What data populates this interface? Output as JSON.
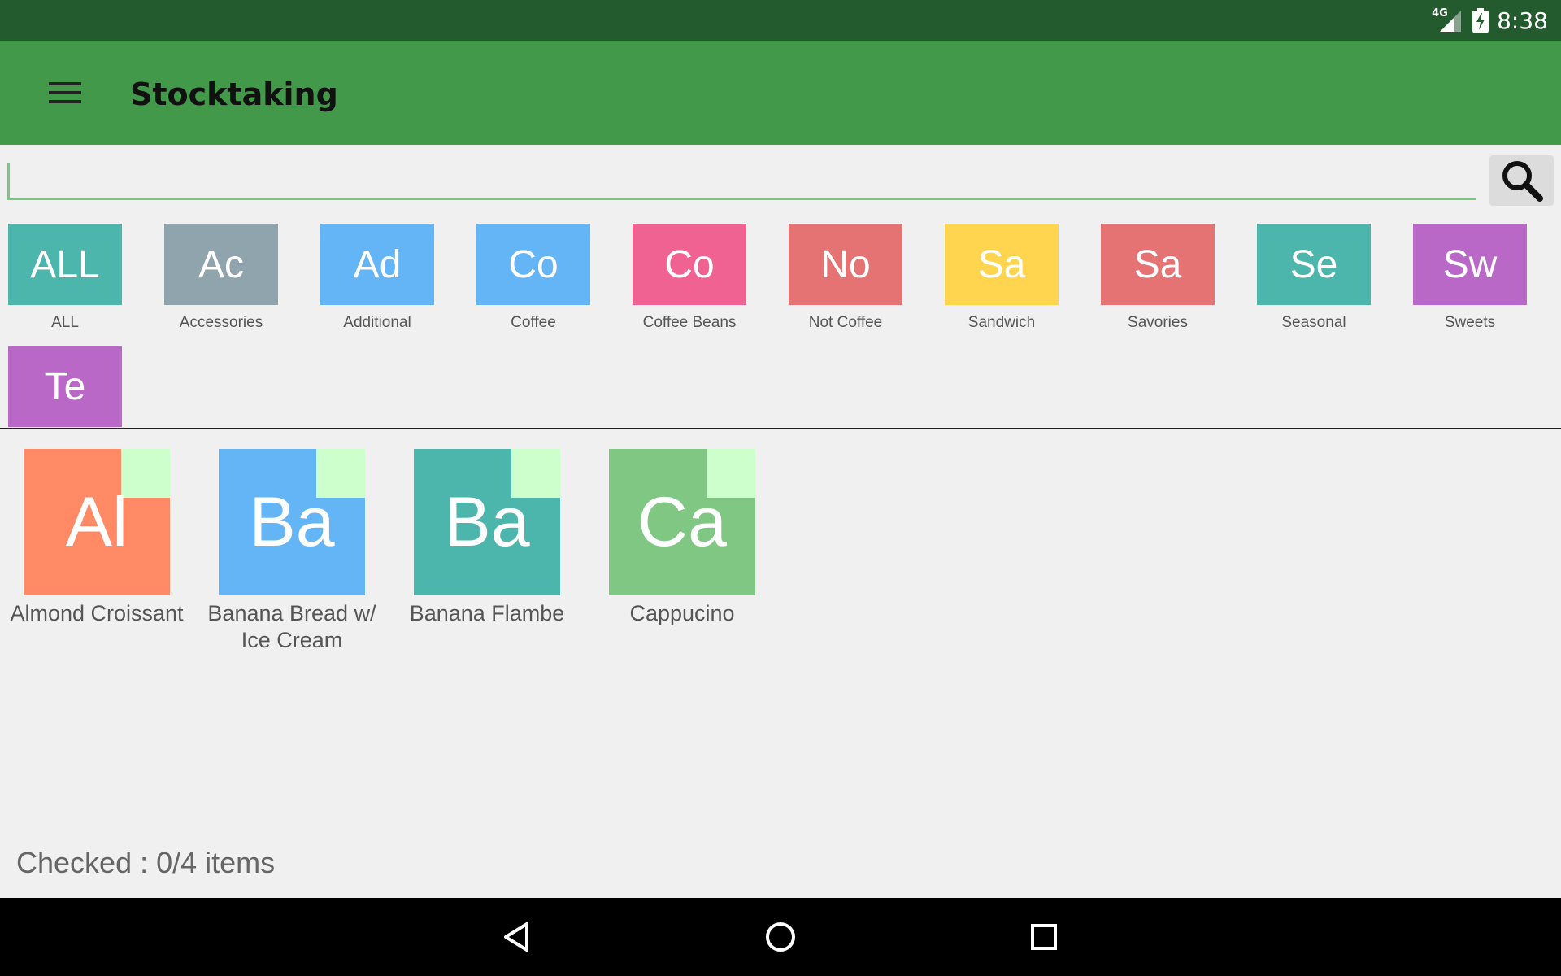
{
  "status_bar": {
    "network": "4G",
    "time": "8:38"
  },
  "app_bar": {
    "title": "Stocktaking",
    "menu_icon": "hamburger-icon"
  },
  "search": {
    "value": "",
    "placeholder": "",
    "button_icon": "search-icon"
  },
  "categories": [
    {
      "abbr": "ALL",
      "label": "ALL",
      "color": "#4db6ac"
    },
    {
      "abbr": "Ac",
      "label": "Accessories",
      "color": "#90a4ae"
    },
    {
      "abbr": "Ad",
      "label": "Additional",
      "color": "#64b5f6"
    },
    {
      "abbr": "Co",
      "label": "Coffee",
      "color": "#64b5f6"
    },
    {
      "abbr": "Co",
      "label": "Coffee Beans",
      "color": "#f06292"
    },
    {
      "abbr": "No",
      "label": "Not Coffee",
      "color": "#e57373"
    },
    {
      "abbr": "Sa",
      "label": "Sandwich",
      "color": "#ffd54f"
    },
    {
      "abbr": "Sa",
      "label": "Savories",
      "color": "#e57373"
    },
    {
      "abbr": "Se",
      "label": "Seasonal",
      "color": "#4db6ac"
    },
    {
      "abbr": "Sw",
      "label": "Sweets",
      "color": "#ba68c8"
    },
    {
      "abbr": "Te",
      "label": "",
      "color": "#ba68c8"
    }
  ],
  "items": [
    {
      "abbr": "Al",
      "name": "Almond Croissant",
      "color": "#ff8a65",
      "checked": false
    },
    {
      "abbr": "Ba",
      "name": "Banana Bread w/ Ice Cream",
      "color": "#64b5f6",
      "checked": false
    },
    {
      "abbr": "Ba",
      "name": "Banana Flambe",
      "color": "#4db6ac",
      "checked": false
    },
    {
      "abbr": "Ca",
      "name": "Cappucino",
      "color": "#81c784",
      "checked": false
    }
  ],
  "footer": {
    "checked_text": "Checked : 0/4 items"
  },
  "nav_bar": {
    "back_icon": "back-icon",
    "home_icon": "home-icon",
    "recents_icon": "recents-icon"
  },
  "colors": {
    "status_bar": "#245b2e",
    "app_bar": "#43994a",
    "check_box": "#ccffcc"
  }
}
